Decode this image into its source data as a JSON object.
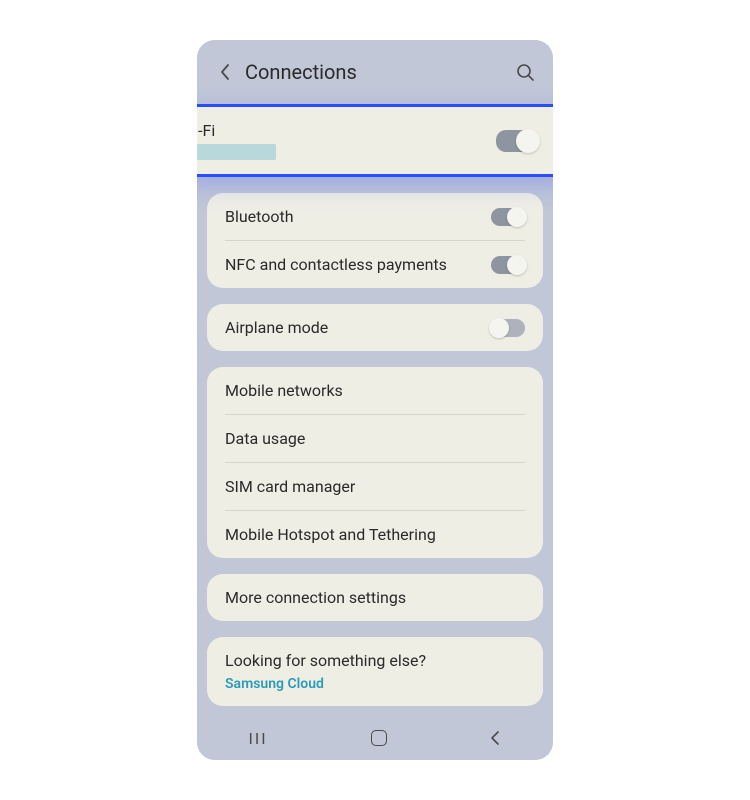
{
  "header": {
    "title": "Connections"
  },
  "highlighted": {
    "wifi_label": "Wi-Fi"
  },
  "group1": {
    "bluetooth": "Bluetooth",
    "nfc": "NFC and contactless payments"
  },
  "group2": {
    "airplane": "Airplane mode"
  },
  "group3": {
    "mobile_networks": "Mobile networks",
    "data_usage": "Data usage",
    "sim": "SIM card manager",
    "hotspot": "Mobile Hotspot and Tethering"
  },
  "group4": {
    "more": "More connection settings"
  },
  "footer": {
    "prompt": "Looking for something else?",
    "link": "Samsung Cloud"
  },
  "toggles": {
    "wifi": true,
    "bluetooth": true,
    "nfc": true,
    "airplane": false
  }
}
